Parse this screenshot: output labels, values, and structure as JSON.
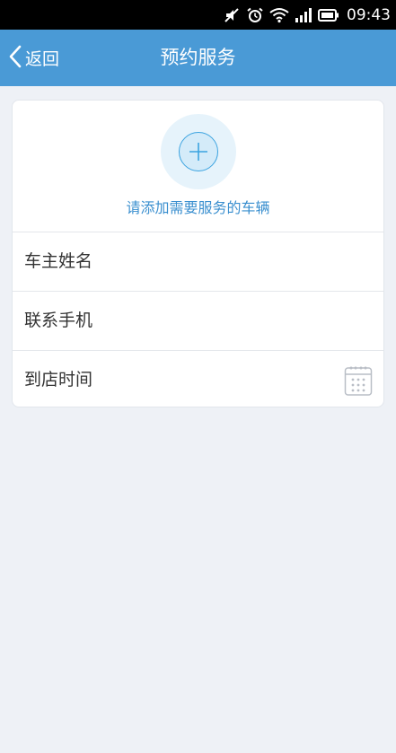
{
  "status_bar": {
    "time": "09:43",
    "icons": [
      "mute-icon",
      "alarm-icon",
      "wifi-icon",
      "signal-icon",
      "battery-icon"
    ]
  },
  "nav": {
    "back_label": "返回",
    "title": "预约服务"
  },
  "add_vehicle": {
    "label": "请添加需要服务的车辆"
  },
  "form": {
    "rows": [
      {
        "label": "车主姓名"
      },
      {
        "label": "联系手机"
      },
      {
        "label": "到店时间",
        "icon": "calendar-icon"
      }
    ]
  },
  "colors": {
    "nav_bg": "#4a9ad6",
    "accent": "#3a8fcf",
    "page_bg": "#eef1f6"
  }
}
